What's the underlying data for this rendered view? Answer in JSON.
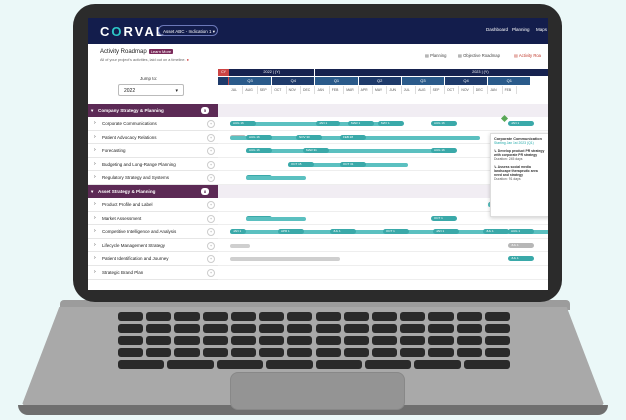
{
  "app": {
    "logo_left": "C",
    "logo_o": "O",
    "logo_rest": "RVAL",
    "asset_selector": "Asset ABC - Indication 1",
    "nav": [
      "Dashboard",
      "Planning",
      "Maps"
    ]
  },
  "header": {
    "title": "Activity Roadmap",
    "learn_more": "Learn More",
    "subtitle": "All of your project's activities, laid out on a timeline.",
    "views": [
      "Planning",
      "Objective Roadmap",
      "Activity Roa"
    ]
  },
  "jump": {
    "label": "Jump to:",
    "value": "2022"
  },
  "timeline": {
    "years": [
      "2022 | (Y)",
      "2023 | (Y)"
    ],
    "quarters": [
      "Q2",
      "Q3",
      "Q4",
      "Q1",
      "Q2",
      "Q3",
      "Q4",
      "Q1"
    ],
    "months": [
      "JUL",
      "AUG",
      "SEP",
      "OCT",
      "NOV",
      "DEC",
      "JAN",
      "FEB",
      "MAR",
      "APR",
      "MAY",
      "JUN",
      "JUL",
      "AUG",
      "SEP",
      "OCT",
      "NOV",
      "DEC",
      "JAN",
      "FEB"
    ],
    "left_cells": [
      "CY",
      "Q"
    ]
  },
  "groups": [
    {
      "name": "Company Strategy & Planning",
      "count": "5",
      "rows": [
        "Corporate Communications",
        "Patient Advocacy Relations",
        "Forecasting",
        "Budgeting and Long-Range Planning",
        "Regulatory Strategy and Systems"
      ]
    },
    {
      "name": "Asset Strategy & Planning",
      "count": "8",
      "rows": [
        "Product Profile and Label",
        "Market Assessment",
        "Competitive Intelligence and Analysis",
        "Lifecycle Management Strategy",
        "Patient Identification and Journey",
        "Strategic Brand Plan"
      ]
    }
  ],
  "pills": [
    "AUG 16",
    "JAN 1",
    "MAR 1",
    "MAY 1",
    "AUG 16",
    "JAN 1",
    "AUG 1",
    "AUG 16",
    "NOV 30",
    "FEB 28",
    "AUG 16",
    "AUG 16",
    "MAR 31",
    "AUG 16",
    "OCT 15",
    "OCT 31",
    "AUG 16",
    "OCT 15",
    "AUG 16",
    "AUG 16",
    "JUL 1",
    "OCT 1",
    "JAN 1",
    "APR 1",
    "JUL 1",
    "OCT 1",
    "JAN 1",
    "JUL 1",
    "AUG 1",
    "JUL 1",
    "JUL 1"
  ],
  "popup": {
    "title": "Corporate Communication",
    "sub": "Starting Jan 1st 2023 (Q1)",
    "item1": "Develop product PR strategy with corporate PR strategy",
    "item1_dur": "Duration: 245 days",
    "item2": "Assess social media landscape therapeutic area need and strategy",
    "item2_dur": "Duration: 91 days"
  },
  "colors": {
    "navy": "#131d4c",
    "plum": "#5c2a55",
    "teal": "#3aa9a9"
  }
}
